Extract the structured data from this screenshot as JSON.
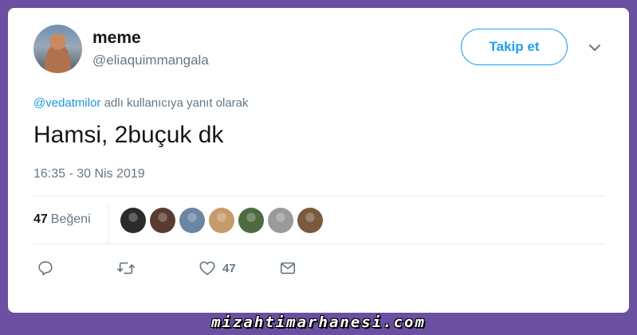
{
  "user": {
    "display_name": "meme",
    "handle": "@eliaquimmangala",
    "avatar_icon": "profile-photo"
  },
  "follow_button": {
    "label": "Takip et",
    "color": "#1da1f2"
  },
  "menu_icon": "chevron-down-icon",
  "reply_context": {
    "mention": "@vedatmilor",
    "text": " adlı kullanıcıya yanıt olarak"
  },
  "tweet": {
    "text": "Hamsi, 2buçuk dk",
    "timestamp": "16:35 - 30 Nis 2019"
  },
  "stats": {
    "likes_count": "47",
    "likes_label": "Beğeni",
    "likers": [
      "#2b2b2b",
      "#5a3b30",
      "#6a86a3",
      "#c79a6a",
      "#4c6b3f",
      "#9a9a9a",
      "#7a5a3a"
    ]
  },
  "actions": {
    "reply_icon": "reply-icon",
    "retweet_icon": "retweet-icon",
    "like_icon": "heart-icon",
    "like_count": "47",
    "dm_icon": "mail-icon"
  },
  "watermark": "mizahtimarhanesi.com"
}
